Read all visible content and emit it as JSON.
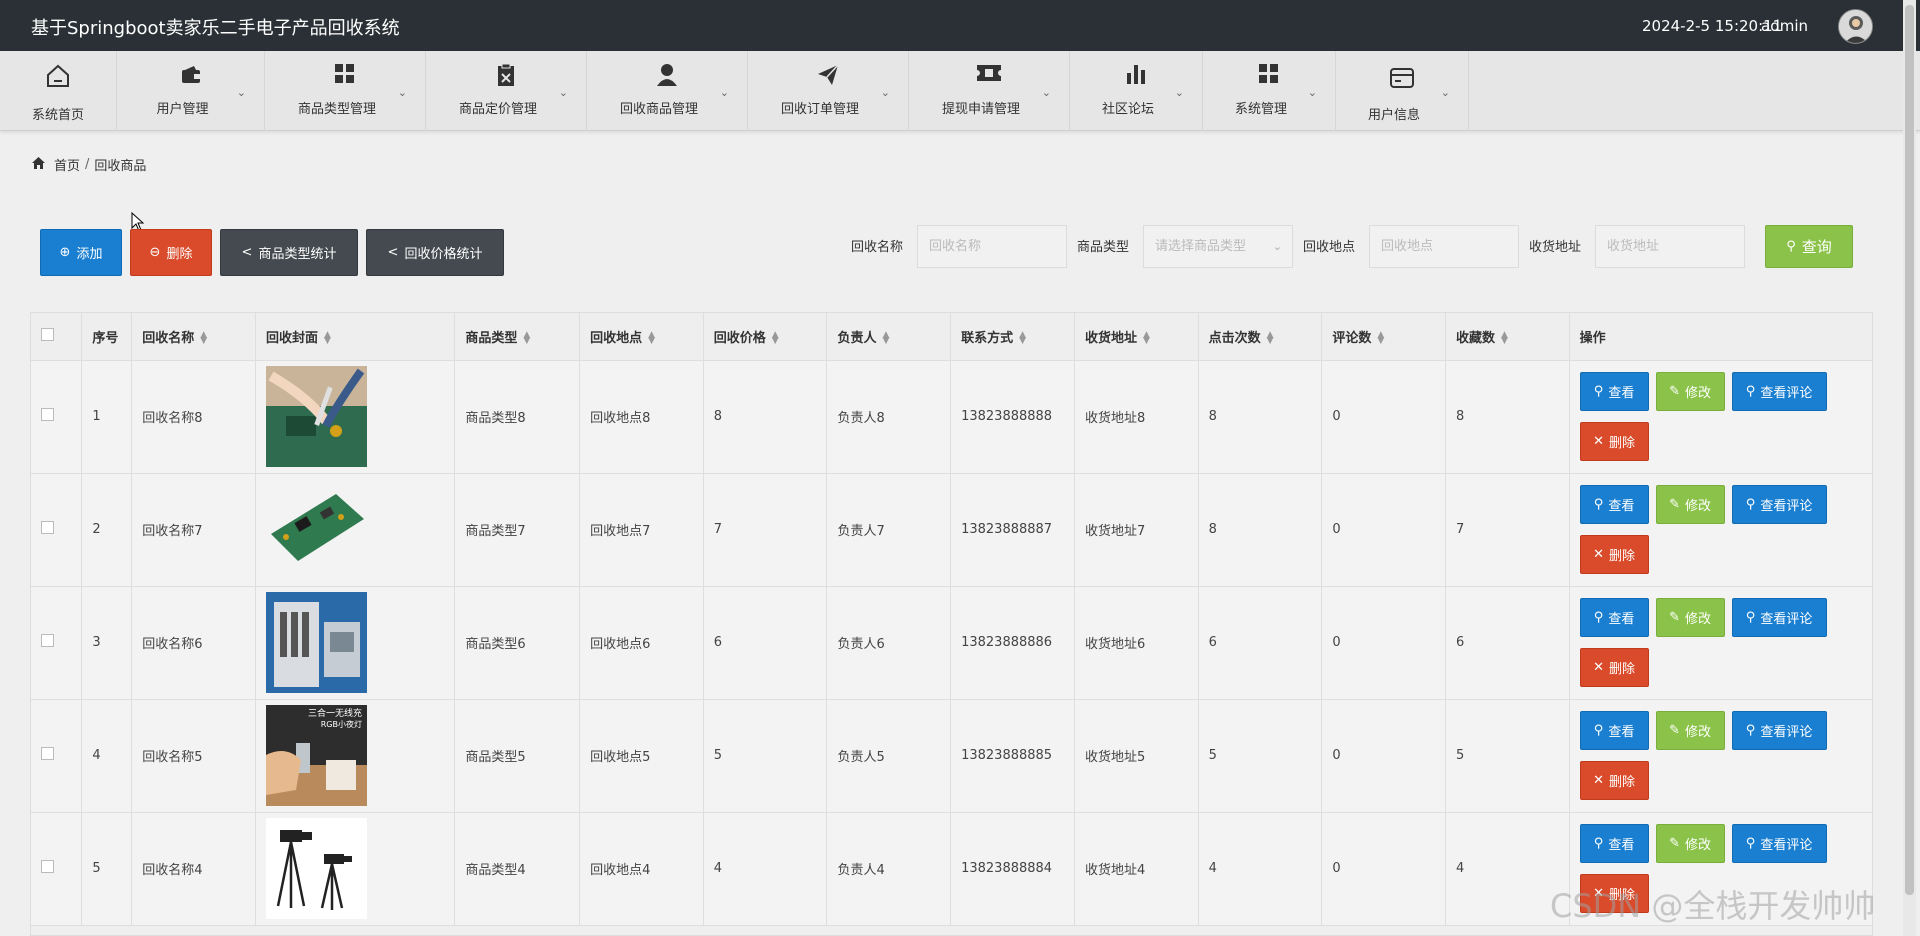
{
  "header": {
    "title": "基于Springboot卖家乐二手电子产品回收系统",
    "datetime": "2024-2-5 15:20:11",
    "username": "admin"
  },
  "nav": [
    {
      "label": "系统首页",
      "icon": "home-icon",
      "has_caret": false
    },
    {
      "label": "用户管理",
      "icon": "wallet-icon",
      "has_caret": true
    },
    {
      "label": "商品类型管理",
      "icon": "grid-icon",
      "has_caret": true
    },
    {
      "label": "商品定价管理",
      "icon": "clipboard-icon",
      "has_caret": true
    },
    {
      "label": "回收商品管理",
      "icon": "user-icon",
      "has_caret": true
    },
    {
      "label": "回收订单管理",
      "icon": "paper-plane-icon",
      "has_caret": true
    },
    {
      "label": "提现申请管理",
      "icon": "ticket-icon",
      "has_caret": true
    },
    {
      "label": "社区论坛",
      "icon": "bar-chart-icon",
      "has_caret": true
    },
    {
      "label": "系统管理",
      "icon": "grid-icon",
      "has_caret": true
    },
    {
      "label": "用户信息",
      "icon": "card-icon",
      "has_caret": true
    }
  ],
  "breadcrumb": {
    "home": "首页",
    "separator": "/",
    "current": "回收商品"
  },
  "toolbar": {
    "add": "添加",
    "delete": "删除",
    "type_stats": "商品类型统计",
    "price_stats": "回收价格统计"
  },
  "filters": {
    "name_label": "回收名称",
    "name_placeholder": "回收名称",
    "type_label": "商品类型",
    "type_placeholder": "请选择商品类型",
    "location_label": "回收地点",
    "location_placeholder": "回收地点",
    "address_label": "收货地址",
    "address_placeholder": "收货地址",
    "search": "查询"
  },
  "table": {
    "columns": [
      "序号",
      "回收名称",
      "回收封面",
      "商品类型",
      "回收地点",
      "回收价格",
      "负责人",
      "联系方式",
      "收货地址",
      "点击次数",
      "评论数",
      "收藏数",
      "操作"
    ],
    "actions": {
      "view": "查看",
      "edit": "修改",
      "comments": "查看评论",
      "delete": "删除"
    },
    "rows": [
      {
        "no": "1",
        "name": "回收名称8",
        "cover": "circuit-repair-photo",
        "type": "商品类型8",
        "location": "回收地点8",
        "price": "8",
        "owner": "负责人8",
        "phone": "13823888888",
        "address": "收货地址8",
        "clicks": "8",
        "comments": "0",
        "favorites": "8"
      },
      {
        "no": "2",
        "name": "回收名称7",
        "cover": "circuit-board-photo",
        "type": "商品类型7",
        "location": "回收地点7",
        "price": "7",
        "owner": "负责人7",
        "phone": "13823888887",
        "address": "收货地址7",
        "clicks": "8",
        "comments": "0",
        "favorites": "7"
      },
      {
        "no": "3",
        "name": "回收名称6",
        "cover": "electrical-cabinet-photo",
        "type": "商品类型6",
        "location": "回收地点6",
        "price": "6",
        "owner": "负责人6",
        "phone": "13823888886",
        "address": "收货地址6",
        "clicks": "6",
        "comments": "0",
        "favorites": "6"
      },
      {
        "no": "4",
        "name": "回收名称5",
        "cover": "wireless-charger-lamp-photo",
        "cover_text": [
          "三合一无线充",
          "RGB小夜灯"
        ],
        "type": "商品类型5",
        "location": "回收地点5",
        "price": "5",
        "owner": "负责人5",
        "phone": "13823888885",
        "address": "收货地址5",
        "clicks": "5",
        "comments": "0",
        "favorites": "5"
      },
      {
        "no": "5",
        "name": "回收名称4",
        "cover": "camera-tripod-photo",
        "type": "商品类型4",
        "location": "回收地点4",
        "price": "4",
        "owner": "负责人4",
        "phone": "13823888884",
        "address": "收货地址4",
        "clicks": "4",
        "comments": "0",
        "favorites": "4"
      }
    ]
  },
  "watermark": "CSDN @全栈开发帅帅",
  "colors": {
    "topbar": "#2a3035",
    "blue": "#1a7fd1",
    "red": "#d94b2b",
    "green": "#8bc34a",
    "dark": "#444a4f"
  }
}
